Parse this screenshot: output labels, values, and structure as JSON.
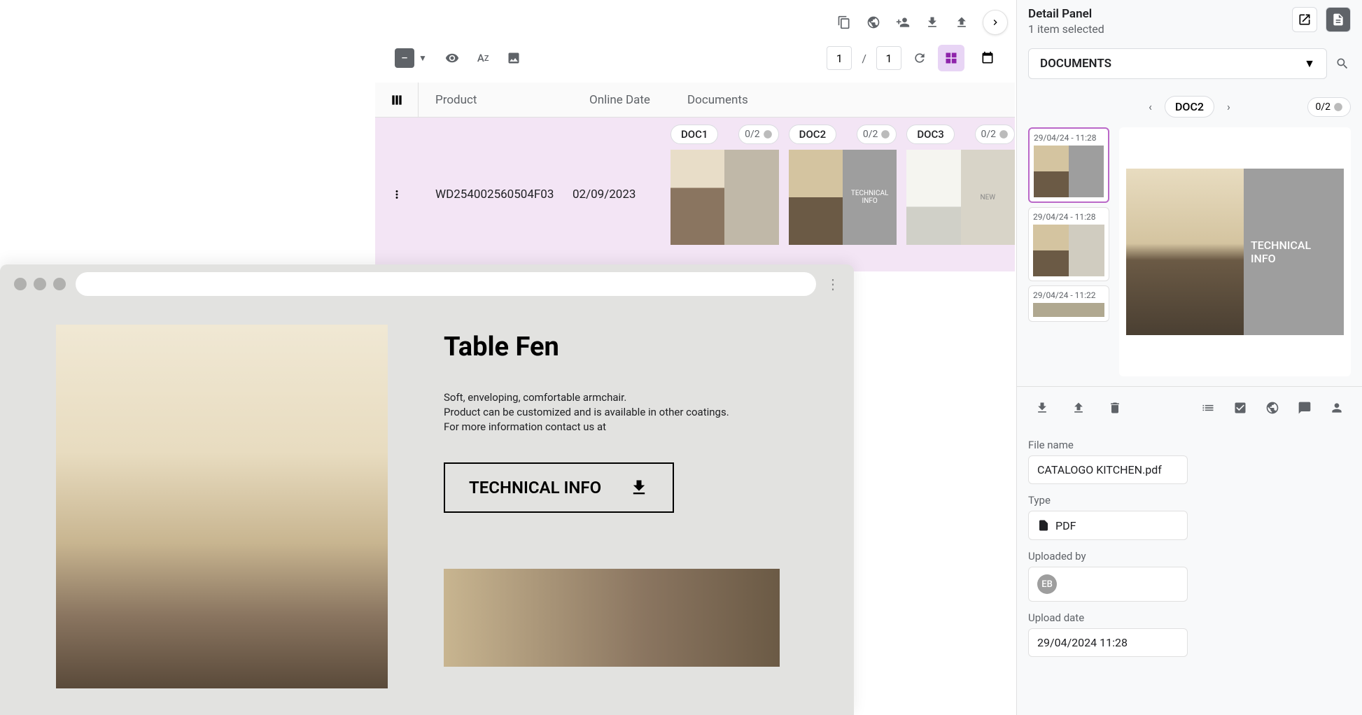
{
  "topIcons": [
    "copy",
    "globe",
    "person-add",
    "download",
    "upload"
  ],
  "toolbar": {
    "page_current": "1",
    "page_total": "1"
  },
  "table": {
    "headers": {
      "product": "Product",
      "online_date": "Online Date",
      "documents": "Documents"
    },
    "row": {
      "product": "WD254002560504F03",
      "date": "02/09/2023",
      "docs": [
        {
          "name": "DOC1",
          "status": "0/2",
          "thumb_right": ""
        },
        {
          "name": "DOC2",
          "status": "0/2",
          "thumb_right": "TECHNICAL INFO"
        },
        {
          "name": "DOC3",
          "status": "0/2",
          "thumb_right": "NEW"
        }
      ]
    }
  },
  "detail": {
    "title": "Detail Panel",
    "subtitle": "1 item selected",
    "dropdown": "DOCUMENTS",
    "nav_label": "DOC2",
    "nav_counter": "0/2",
    "thumbs": [
      {
        "date": "29/04/24 - 11:28",
        "selected": true
      },
      {
        "date": "29/04/24 - 11:28",
        "selected": false
      },
      {
        "date": "29/04/24 - 11:22",
        "selected": false
      }
    ],
    "preview_label": "TECHNICAL INFO",
    "fields": {
      "filename_label": "File name",
      "filename_value": "CATALOGO KITCHEN.pdf",
      "type_label": "Type",
      "type_value": "PDF",
      "uploaded_by_label": "Uploaded by",
      "uploaded_by_initials": "EB",
      "upload_date_label": "Upload date",
      "upload_date_value": "29/04/2024 11:28"
    }
  },
  "browser": {
    "title": "Table Fen",
    "desc_line1": "Soft, enveloping, comfortable armchair.",
    "desc_line2": "Product can be customized and is available in other coatings.",
    "desc_line3": "For more information contact us at",
    "button": "TECHNICAL INFO"
  }
}
